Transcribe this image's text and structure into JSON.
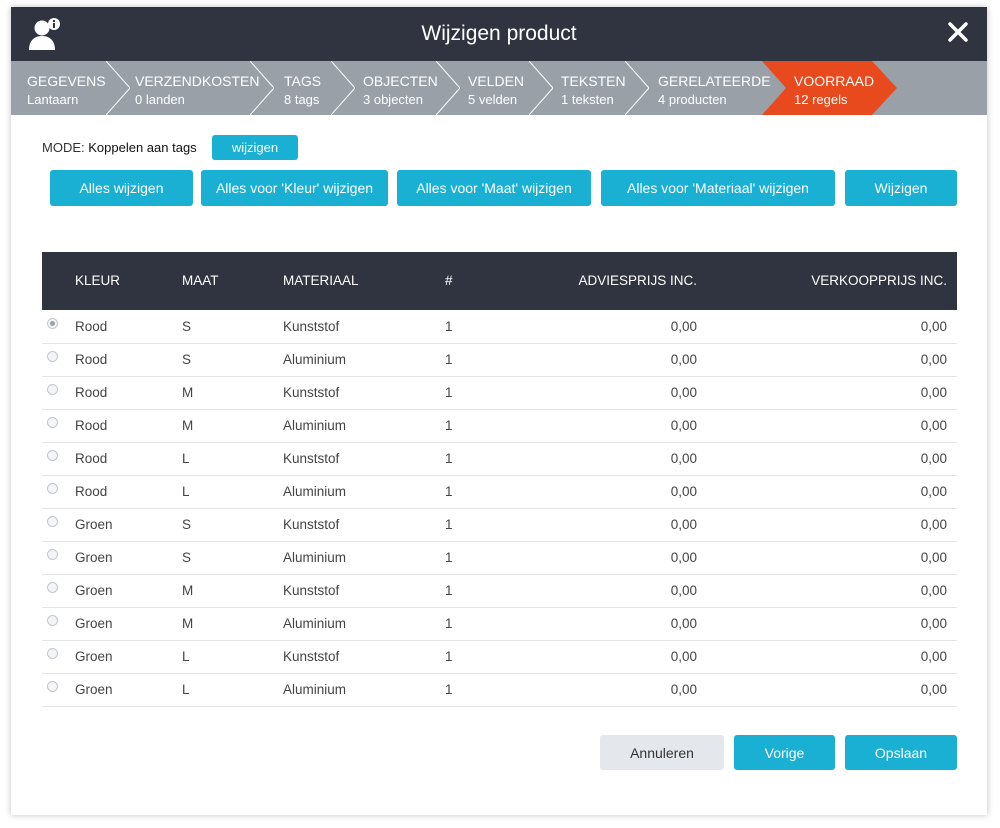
{
  "dialog": {
    "title": "Wijzigen product",
    "close_icon": "close-icon",
    "user_icon": "user-info-icon"
  },
  "steps": [
    {
      "label": "GEGEVENS",
      "sub": "Lantaarn"
    },
    {
      "label": "VERZENDKOSTEN",
      "sub": "0 landen"
    },
    {
      "label": "TAGS",
      "sub": "8 tags"
    },
    {
      "label": "OBJECTEN",
      "sub": "3 objecten"
    },
    {
      "label": "VELDEN",
      "sub": "5 velden"
    },
    {
      "label": "TEKSTEN",
      "sub": "1 teksten"
    },
    {
      "label": "GERELATEERDE",
      "sub": "4 producten"
    },
    {
      "label": "VOORRAAD",
      "sub": "12 regels"
    }
  ],
  "colors": {
    "accent": "#1ab0d4",
    "active_step": "#e8491d",
    "dark": "#2f3440",
    "steps_bg": "#9aa0a8"
  },
  "mode": {
    "label": "MODE:",
    "value": "Koppelen aan tags",
    "change_button": "wijzigen"
  },
  "actions": {
    "all": "Alles wijzigen",
    "kleur": "Alles voor 'Kleur' wijzigen",
    "maat": "Alles voor 'Maat' wijzigen",
    "materiaal": "Alles voor 'Materiaal' wijzigen",
    "edit": "Wijzigen"
  },
  "table": {
    "headers": {
      "kleur": "KLEUR",
      "maat": "MAAT",
      "materiaal": "MATERIAAL",
      "count": "#",
      "advies": "ADVIESPRIJS INC.",
      "verkoop": "VERKOOPPRIJS INC."
    },
    "rows": [
      {
        "kleur": "Rood",
        "maat": "S",
        "materiaal": "Kunststof",
        "count": "1",
        "advies": "0,00",
        "verkoop": "0,00",
        "selected": true
      },
      {
        "kleur": "Rood",
        "maat": "S",
        "materiaal": "Aluminium",
        "count": "1",
        "advies": "0,00",
        "verkoop": "0,00",
        "selected": false
      },
      {
        "kleur": "Rood",
        "maat": "M",
        "materiaal": "Kunststof",
        "count": "1",
        "advies": "0,00",
        "verkoop": "0,00",
        "selected": false
      },
      {
        "kleur": "Rood",
        "maat": "M",
        "materiaal": "Aluminium",
        "count": "1",
        "advies": "0,00",
        "verkoop": "0,00",
        "selected": false
      },
      {
        "kleur": "Rood",
        "maat": "L",
        "materiaal": "Kunststof",
        "count": "1",
        "advies": "0,00",
        "verkoop": "0,00",
        "selected": false
      },
      {
        "kleur": "Rood",
        "maat": "L",
        "materiaal": "Aluminium",
        "count": "1",
        "advies": "0,00",
        "verkoop": "0,00",
        "selected": false
      },
      {
        "kleur": "Groen",
        "maat": "S",
        "materiaal": "Kunststof",
        "count": "1",
        "advies": "0,00",
        "verkoop": "0,00",
        "selected": false
      },
      {
        "kleur": "Groen",
        "maat": "S",
        "materiaal": "Aluminium",
        "count": "1",
        "advies": "0,00",
        "verkoop": "0,00",
        "selected": false
      },
      {
        "kleur": "Groen",
        "maat": "M",
        "materiaal": "Kunststof",
        "count": "1",
        "advies": "0,00",
        "verkoop": "0,00",
        "selected": false
      },
      {
        "kleur": "Groen",
        "maat": "M",
        "materiaal": "Aluminium",
        "count": "1",
        "advies": "0,00",
        "verkoop": "0,00",
        "selected": false
      },
      {
        "kleur": "Groen",
        "maat": "L",
        "materiaal": "Kunststof",
        "count": "1",
        "advies": "0,00",
        "verkoop": "0,00",
        "selected": false
      },
      {
        "kleur": "Groen",
        "maat": "L",
        "materiaal": "Aluminium",
        "count": "1",
        "advies": "0,00",
        "verkoop": "0,00",
        "selected": false
      }
    ]
  },
  "footer": {
    "cancel": "Annuleren",
    "previous": "Vorige",
    "save": "Opslaan"
  }
}
